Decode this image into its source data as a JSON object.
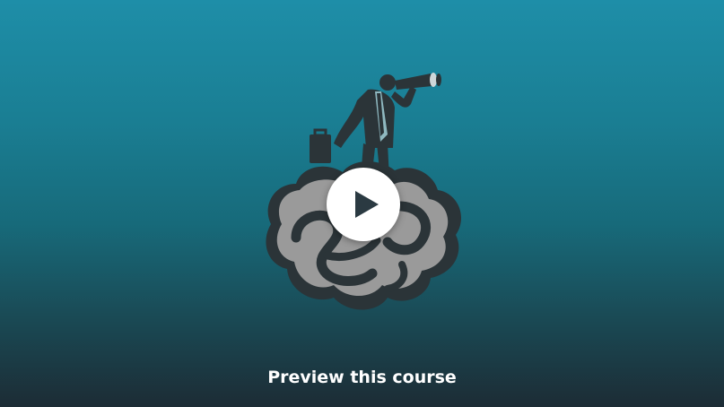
{
  "preview": {
    "caption": "Preview this course",
    "play_icon": "play-icon",
    "illustration": "businessman-with-telescope-on-brain-illustration"
  },
  "colors": {
    "background_top": "#1e8ea8",
    "background_bottom": "#1c2c35",
    "brain_fill": "#9a9a9a",
    "brain_outline": "#2b3438",
    "play_circle": "#ffffff",
    "play_triangle": "#2b3a42"
  }
}
